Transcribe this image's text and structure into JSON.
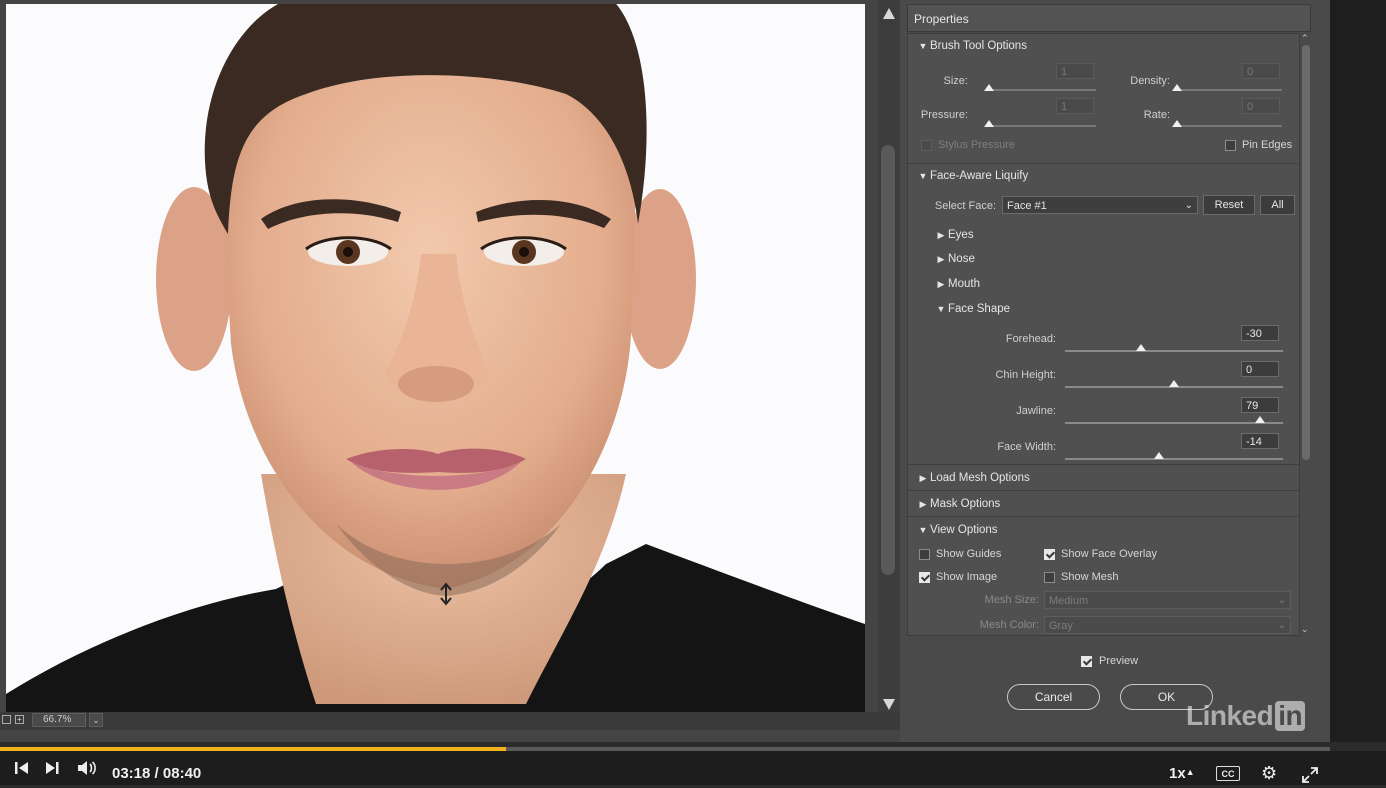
{
  "canvas": {
    "zoom": "66.7%"
  },
  "panel": {
    "title": "Properties",
    "brush_tool_options": {
      "label": "Brush Tool Options",
      "size_label": "Size:",
      "size_value": "1",
      "density_label": "Density:",
      "density_value": "0",
      "pressure_label": "Pressure:",
      "pressure_value": "1",
      "rate_label": "Rate:",
      "rate_value": "0",
      "stylus_pressure": {
        "label": "Stylus Pressure",
        "checked": false
      },
      "pin_edges": {
        "label": "Pin Edges",
        "checked": false
      }
    },
    "face_aware_liquify": {
      "label": "Face-Aware Liquify",
      "select_face_label": "Select Face:",
      "select_face_value": "Face #1",
      "reset_label": "Reset",
      "all_label": "All",
      "subsections": [
        "Eyes",
        "Nose",
        "Mouth"
      ],
      "face_shape": {
        "label": "Face Shape",
        "sliders": [
          {
            "label": "Forehead:",
            "value": "-30",
            "fraction": 0.35
          },
          {
            "label": "Chin Height:",
            "value": "0",
            "fraction": 0.5
          },
          {
            "label": "Jawline:",
            "value": "79",
            "fraction": 0.895
          },
          {
            "label": "Face Width:",
            "value": "-14",
            "fraction": 0.43
          }
        ]
      }
    },
    "load_mesh_options": {
      "label": "Load Mesh Options"
    },
    "mask_options": {
      "label": "Mask Options"
    },
    "view_options": {
      "label": "View Options",
      "show_guides": {
        "label": "Show Guides",
        "checked": false
      },
      "show_face_overlay": {
        "label": "Show Face Overlay",
        "checked": true
      },
      "show_image": {
        "label": "Show Image",
        "checked": true
      },
      "show_mesh": {
        "label": "Show Mesh",
        "checked": false
      },
      "mesh_size_label": "Mesh Size:",
      "mesh_size_value": "Medium",
      "mesh_color_label": "Mesh Color:",
      "mesh_color_value": "Gray"
    },
    "preview": {
      "label": "Preview",
      "checked": true
    },
    "cancel_label": "Cancel",
    "ok_label": "OK"
  },
  "watermark": {
    "text": "Linked",
    "badge": "in"
  },
  "player": {
    "current_time": "03:18",
    "separator": "/",
    "total_time": "08:40",
    "progress": 0.3808,
    "speed": "1x",
    "cc": "CC",
    "accent_color": "#f2b21b"
  }
}
